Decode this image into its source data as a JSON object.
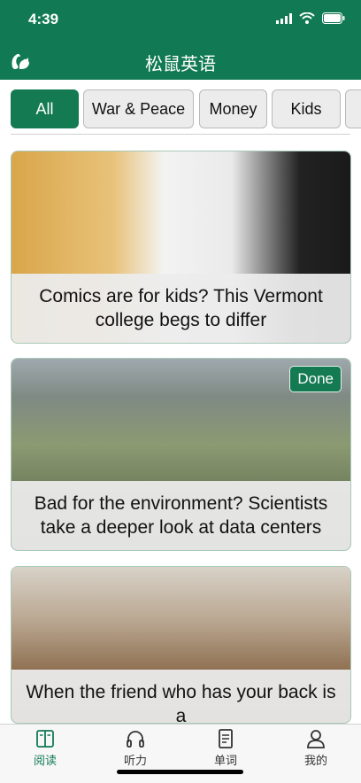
{
  "status": {
    "time": "4:39"
  },
  "app": {
    "title": "松鼠英语"
  },
  "tabs": [
    {
      "label": "All",
      "active": true
    },
    {
      "label": "War & Peace",
      "active": false
    },
    {
      "label": "Money",
      "active": false
    },
    {
      "label": "Kids",
      "active": false
    }
  ],
  "articles": [
    {
      "title": "Comics are for kids? This Vermont college begs to differ",
      "status": ""
    },
    {
      "title": "Bad for the environment? Scientists take a deeper look at data centers",
      "status": "Done"
    },
    {
      "title": "When the friend who has your back is a",
      "status": ""
    }
  ],
  "bottom_nav": [
    {
      "label": "阅读",
      "icon": "book-icon",
      "active": true
    },
    {
      "label": "听力",
      "icon": "headphones-icon",
      "active": false
    },
    {
      "label": "单词",
      "icon": "document-icon",
      "active": false
    },
    {
      "label": "我的",
      "icon": "person-icon",
      "active": false
    }
  ],
  "colors": {
    "brand": "#117a55",
    "tab_active": "#147a52",
    "tab_inactive": "#ececec"
  }
}
